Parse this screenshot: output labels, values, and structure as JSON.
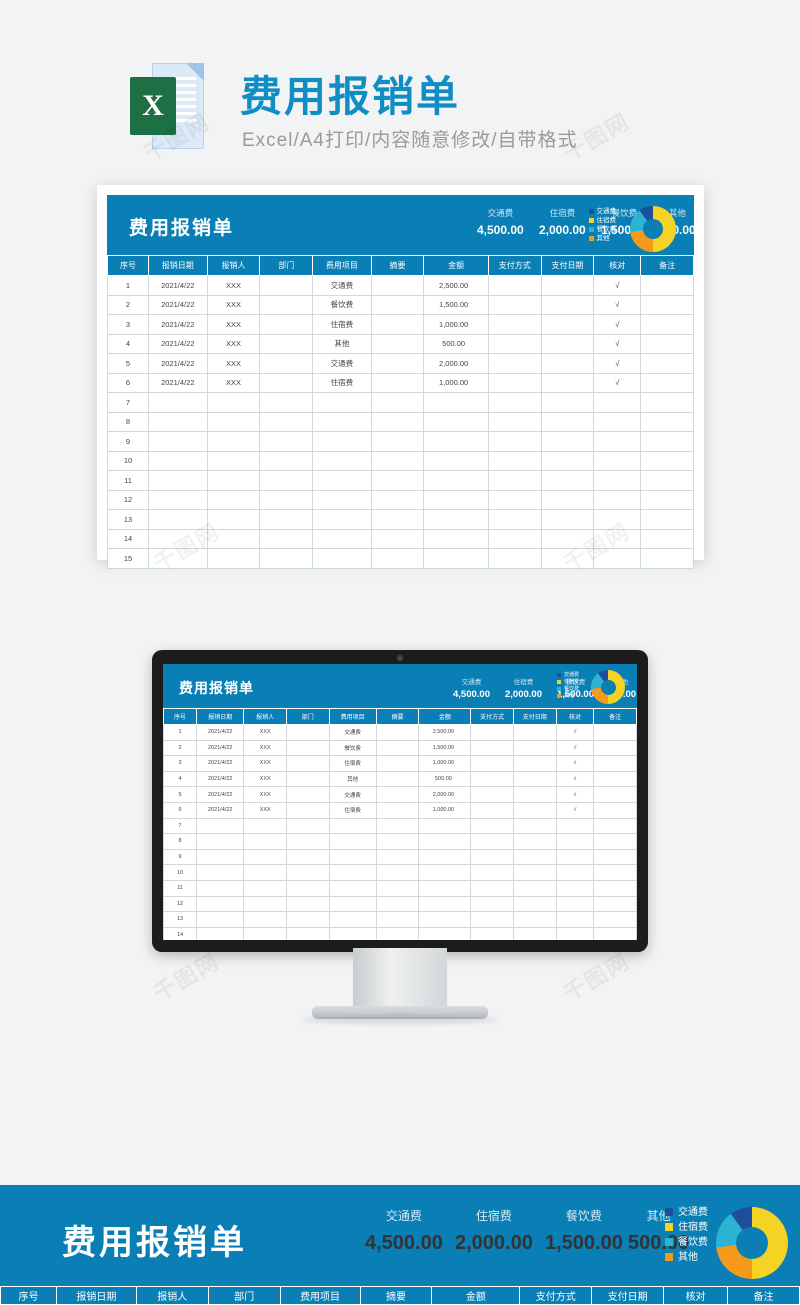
{
  "header": {
    "title": "费用报销单",
    "subtitle": "Excel/A4打印/内容随意修改/自带格式",
    "icon_letter": "X",
    "icon_name": "excel-file-icon"
  },
  "sheet": {
    "banner_title": "费用报销单",
    "summary": [
      {
        "label": "交通费",
        "value": "4,500.00",
        "color": "#1f4e9c"
      },
      {
        "label": "住宿费",
        "value": "2,000.00",
        "color": "#f5d324"
      },
      {
        "label": "餐饮费",
        "value": "1,500.00",
        "color": "#2bb3d4"
      },
      {
        "label": "其他",
        "value": "500.00",
        "color": "#f59b1c"
      }
    ],
    "legend": [
      "交通费",
      "住宿费",
      "餐饮费",
      "其他"
    ],
    "columns": [
      "序号",
      "报销日期",
      "报销人",
      "部门",
      "费用项目",
      "摘要",
      "金额",
      "支付方式",
      "支付日期",
      "核对",
      "备注"
    ],
    "rows": [
      {
        "no": "1",
        "date": "2021/4/22",
        "person": "XXX",
        "dept": "",
        "item": "交通费",
        "memo": "",
        "amount": "2,500.00",
        "pay": "",
        "paydate": "",
        "check": "√",
        "remark": ""
      },
      {
        "no": "2",
        "date": "2021/4/22",
        "person": "XXX",
        "dept": "",
        "item": "餐饮费",
        "memo": "",
        "amount": "1,500.00",
        "pay": "",
        "paydate": "",
        "check": "√",
        "remark": ""
      },
      {
        "no": "3",
        "date": "2021/4/22",
        "person": "XXX",
        "dept": "",
        "item": "住宿费",
        "memo": "",
        "amount": "1,000.00",
        "pay": "",
        "paydate": "",
        "check": "√",
        "remark": ""
      },
      {
        "no": "4",
        "date": "2021/4/22",
        "person": "XXX",
        "dept": "",
        "item": "其他",
        "memo": "",
        "amount": "500.00",
        "pay": "",
        "paydate": "",
        "check": "√",
        "remark": ""
      },
      {
        "no": "5",
        "date": "2021/4/22",
        "person": "XXX",
        "dept": "",
        "item": "交通费",
        "memo": "",
        "amount": "2,000.00",
        "pay": "",
        "paydate": "",
        "check": "√",
        "remark": ""
      },
      {
        "no": "6",
        "date": "2021/4/22",
        "person": "XXX",
        "dept": "",
        "item": "住宿费",
        "memo": "",
        "amount": "1,000.00",
        "pay": "",
        "paydate": "",
        "check": "√",
        "remark": ""
      },
      {
        "no": "7",
        "date": "",
        "person": "",
        "dept": "",
        "item": "",
        "memo": "",
        "amount": "",
        "pay": "",
        "paydate": "",
        "check": "",
        "remark": ""
      },
      {
        "no": "8",
        "date": "",
        "person": "",
        "dept": "",
        "item": "",
        "memo": "",
        "amount": "",
        "pay": "",
        "paydate": "",
        "check": "",
        "remark": ""
      },
      {
        "no": "9",
        "date": "",
        "person": "",
        "dept": "",
        "item": "",
        "memo": "",
        "amount": "",
        "pay": "",
        "paydate": "",
        "check": "",
        "remark": ""
      },
      {
        "no": "10",
        "date": "",
        "person": "",
        "dept": "",
        "item": "",
        "memo": "",
        "amount": "",
        "pay": "",
        "paydate": "",
        "check": "",
        "remark": ""
      },
      {
        "no": "11",
        "date": "",
        "person": "",
        "dept": "",
        "item": "",
        "memo": "",
        "amount": "",
        "pay": "",
        "paydate": "",
        "check": "",
        "remark": ""
      },
      {
        "no": "12",
        "date": "",
        "person": "",
        "dept": "",
        "item": "",
        "memo": "",
        "amount": "",
        "pay": "",
        "paydate": "",
        "check": "",
        "remark": ""
      },
      {
        "no": "13",
        "date": "",
        "person": "",
        "dept": "",
        "item": "",
        "memo": "",
        "amount": "",
        "pay": "",
        "paydate": "",
        "check": "",
        "remark": ""
      },
      {
        "no": "14",
        "date": "",
        "person": "",
        "dept": "",
        "item": "",
        "memo": "",
        "amount": "",
        "pay": "",
        "paydate": "",
        "check": "",
        "remark": ""
      },
      {
        "no": "15",
        "date": "",
        "person": "",
        "dept": "",
        "item": "",
        "memo": "",
        "amount": "",
        "pay": "",
        "paydate": "",
        "check": "",
        "remark": ""
      }
    ]
  },
  "watermark": {
    "text": "千图网"
  },
  "theme": {
    "blue": "#0a7fb5",
    "title_blue": "#0f8ec4"
  }
}
